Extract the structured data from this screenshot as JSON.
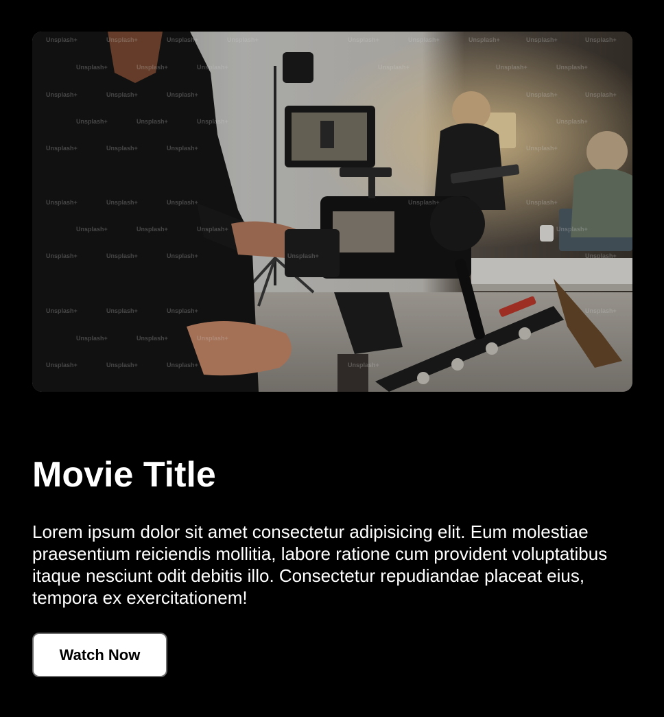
{
  "hero": {
    "watermark_text": "Unsplash+"
  },
  "movie": {
    "title": "Movie Title",
    "description": "Lorem ipsum dolor sit amet consectetur adipisicing elit. Eum molestiae praesentium reiciendis mollitia, labore ratione cum provident voluptatibus itaque nesciunt odit debitis illo. Consectetur repudiandae placeat eius, tempora ex exercitationem!",
    "cta_label": "Watch Now"
  },
  "colors": {
    "background": "#000000",
    "text": "#ffffff",
    "button_bg": "#ffffff",
    "button_text": "#000000"
  }
}
